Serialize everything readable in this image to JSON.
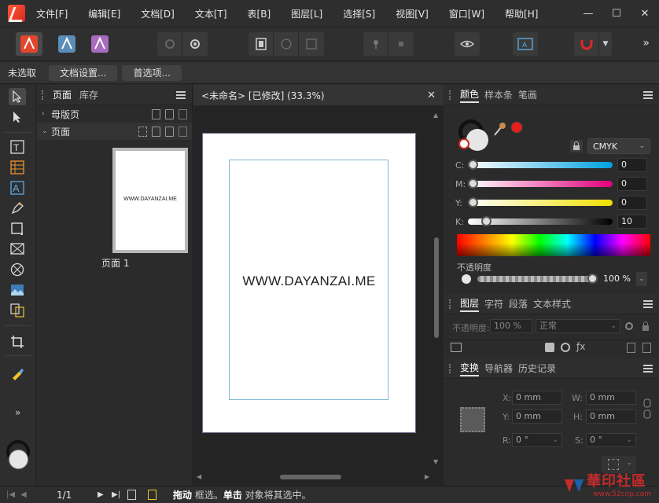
{
  "menu": {
    "items": [
      "文件[F]",
      "编辑[E]",
      "文档[D]",
      "文本[T]",
      "表[B]",
      "图层[L]",
      "选择[S]",
      "视图[V]",
      "窗口[W]",
      "帮助[H]"
    ],
    "window_controls": [
      "—",
      "☐",
      "✕"
    ]
  },
  "toolbar": {
    "more": "»"
  },
  "context": {
    "selection": "未选取",
    "doc_setup": "文档设置...",
    "preferences": "首选项..."
  },
  "pages_panel": {
    "tabs": [
      "页面",
      "库存"
    ],
    "master_pages": "母版页",
    "pages": "页面",
    "thumb_text": "WWW.DAYANZAI.ME",
    "page_label": "页面 1"
  },
  "document": {
    "tab_title": "<未命名> [已修改] (33.3%)",
    "close": "✕",
    "canvas_text": "WWW.DAYANZAI.ME"
  },
  "color_panel": {
    "tabs": [
      "颜色",
      "样本条",
      "笔画"
    ],
    "model": "CMYK",
    "channels": [
      {
        "label": "C:",
        "value": "0",
        "level": 0
      },
      {
        "label": "M:",
        "value": "0",
        "level": 0
      },
      {
        "label": "Y:",
        "value": "0",
        "level": 0
      },
      {
        "label": "K:",
        "value": "10",
        "level": 10
      }
    ],
    "opacity_label": "不透明度",
    "opacity_value": "100 %"
  },
  "layers_panel": {
    "tabs": [
      "图层",
      "字符",
      "段落",
      "文本样式"
    ],
    "opacity_label": "不透明度:",
    "opacity_value": "100 %",
    "blend_mode": "正常"
  },
  "transform_panel": {
    "tabs": [
      "变换",
      "导航器",
      "历史记录"
    ],
    "x_label": "X:",
    "x_value": "0 mm",
    "y_label": "Y:",
    "y_value": "0 mm",
    "w_label": "W:",
    "w_value": "0 mm",
    "h_label": "H:",
    "h_value": "0 mm",
    "r_label": "R:",
    "r_value": "0 °",
    "s_label": "S:",
    "s_value": "0 °"
  },
  "statusbar": {
    "page": "1/1",
    "hint_drag": "拖动",
    "hint_drag_desc": " 框选。",
    "hint_click": "单击",
    "hint_click_desc": " 对象将其选中。"
  },
  "watermark": {
    "main": "華印社區",
    "url": "www.52cnp.com"
  },
  "colors": {
    "accent": "#e0472e",
    "primary_fill": "#e6e6e6",
    "picker_red": "#e81e1e"
  }
}
